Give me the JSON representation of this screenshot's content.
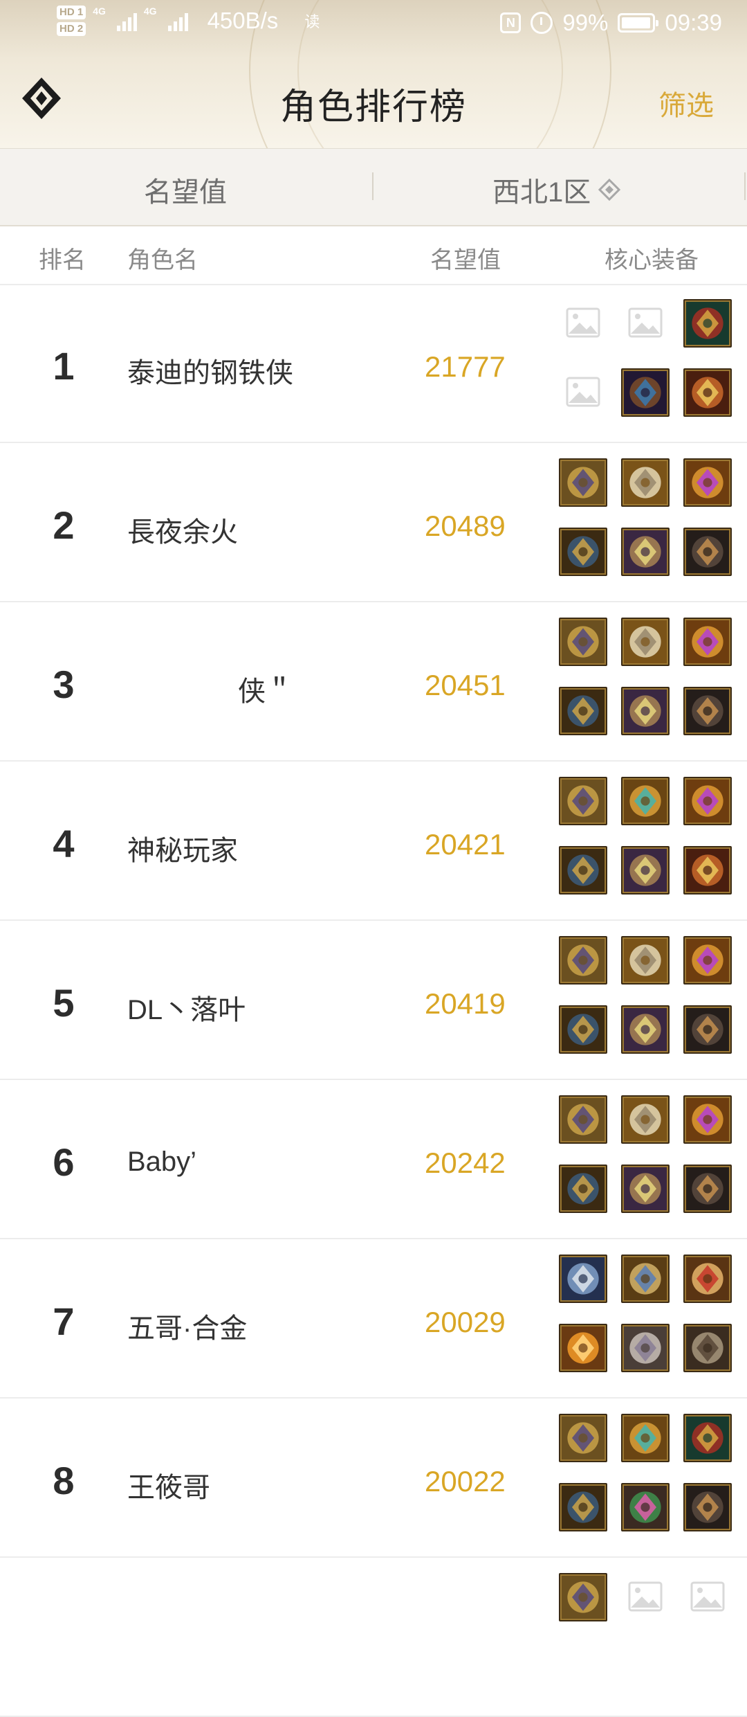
{
  "status_bar": {
    "sim1": "HD 1",
    "sim2": "HD 2",
    "network": "4G",
    "speed": "450B/s",
    "read_label": "读",
    "battery": "99%",
    "time": "09:39"
  },
  "header": {
    "title": "角色排行榜",
    "filter_label": "筛选"
  },
  "filters": {
    "metric": "名望值",
    "server": "西北1区"
  },
  "columns": {
    "rank": "排名",
    "name": "角色名",
    "fame": "名望值",
    "equipment": "核心装备"
  },
  "rows": [
    {
      "rank": "1",
      "name": "泰迪的钢铁侠",
      "fame": "21777",
      "items": [
        "placeholder",
        "placeholder",
        "armor-red-icon",
        "placeholder",
        "armor-dark-icon",
        "armor-gold-icon"
      ]
    },
    {
      "rank": "2",
      "name": "長夜余火",
      "fame": "20489",
      "items": [
        "weapon-icon",
        "ring-silver-icon",
        "necklace-purple-icon",
        "bracer-icon",
        "chest-purple-icon",
        "legs-dark-icon"
      ]
    },
    {
      "rank": "3",
      "name": "　　　　侠＂",
      "fame": "20451",
      "items": [
        "weapon-icon",
        "ring-silver-icon",
        "necklace-purple-icon",
        "bracer-icon",
        "chest-purple-icon",
        "legs-dark-icon"
      ]
    },
    {
      "rank": "4",
      "name": "神秘玩家",
      "fame": "20421",
      "items": [
        "weapon-icon",
        "ring-gem-icon",
        "necklace-purple-icon",
        "bracer-icon",
        "chest-purple-icon",
        "armor-gold-icon"
      ]
    },
    {
      "rank": "5",
      "name": "DL丶落叶",
      "fame": "20419",
      "items": [
        "weapon-icon",
        "ring-silver-icon",
        "necklace-purple-icon",
        "bracer-icon",
        "chest-purple-icon",
        "legs-dark-icon"
      ]
    },
    {
      "rank": "6",
      "name": "Baby’",
      "fame": "20242",
      "items": [
        "weapon-icon",
        "ring-silver-icon",
        "necklace-purple-icon",
        "bracer-icon",
        "chest-purple-icon",
        "legs-dark-icon"
      ]
    },
    {
      "rank": "7",
      "name": "五哥·合金",
      "fame": "20029",
      "items": [
        "weapon-blue-icon",
        "ring-blue-icon",
        "amulet-red-icon",
        "orb-orange-icon",
        "chest-silver-icon",
        "armor-silver-icon"
      ]
    },
    {
      "rank": "8",
      "name": "王筱哥",
      "fame": "20022",
      "items": [
        "weapon-icon",
        "ring-gem-icon",
        "armor-red-icon",
        "bracer-icon",
        "chest-green-icon",
        "legs-dark-icon"
      ]
    },
    {
      "rank": "",
      "name": "",
      "fame": "",
      "items": [
        "weapon-icon",
        "placeholder",
        "placeholder"
      ]
    }
  ],
  "colors": {
    "accent_gold": "#d9a625",
    "filter_gold": "#d9a93a",
    "text_dark": "#2d2d2d",
    "header_gray": "#8a8a8a"
  },
  "item_colors": {
    "weapon-icon": [
      "#6b5020",
      "#c9a24a",
      "#5a4c7a"
    ],
    "weapon-blue-icon": [
      "#24304f",
      "#7f9fc8",
      "#d7dfe8"
    ],
    "ring-silver-icon": [
      "#7a5318",
      "#e5d8b5",
      "#9b8c70"
    ],
    "ring-gem-icon": [
      "#6a4513",
      "#d9a03a",
      "#4bb3a7"
    ],
    "ring-blue-icon": [
      "#5a3d14",
      "#d4b36a",
      "#5d7fb3"
    ],
    "necklace-purple-icon": [
      "#6e3d0f",
      "#e09a32",
      "#b544c9"
    ],
    "amulet-red-icon": [
      "#5a3413",
      "#e7b56b",
      "#c63c2c"
    ],
    "bracer-icon": [
      "#3b2a12",
      "#3c5a7a",
      "#c49d48"
    ],
    "chest-purple-icon": [
      "#3a2742",
      "#a88452",
      "#e1d07a"
    ],
    "chest-silver-icon": [
      "#4a3e38",
      "#c9c0b8",
      "#8b7f96"
    ],
    "chest-green-icon": [
      "#3a2a22",
      "#3f8f4e",
      "#d65ea4"
    ],
    "legs-dark-icon": [
      "#241d1a",
      "#5a4a40",
      "#bc8b4e"
    ],
    "armor-red-icon": [
      "#173a2e",
      "#a42f23",
      "#d0a040"
    ],
    "armor-dark-icon": [
      "#221833",
      "#7a4c2a",
      "#3b77a8"
    ],
    "armor-gold-icon": [
      "#4a1e0f",
      "#c9692a",
      "#e8c15a"
    ],
    "armor-silver-icon": [
      "#3a2c20",
      "#a8987e",
      "#5b4a3a"
    ],
    "orb-orange-icon": [
      "#6a3a12",
      "#f29a28",
      "#ffd27a"
    ]
  }
}
